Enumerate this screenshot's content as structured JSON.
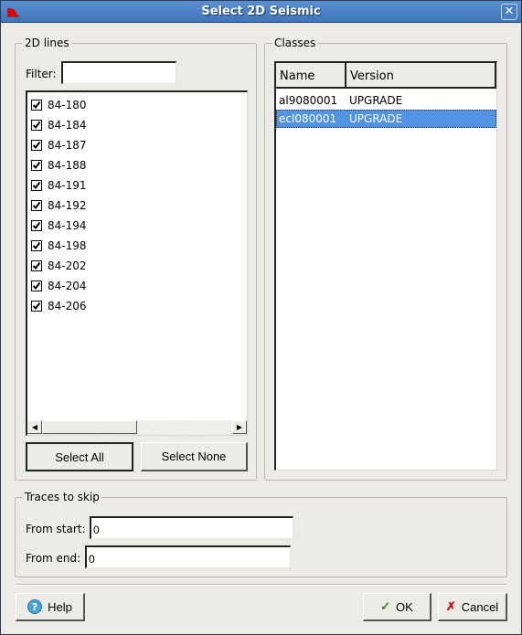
{
  "window": {
    "title": "Select 2D Seismic",
    "app_icon": "seismic-app-icon",
    "close_icon": "close-icon"
  },
  "lines_group": {
    "label": "2D lines",
    "filter_label": "Filter:",
    "filter_value": "",
    "items": [
      {
        "label": "84-180",
        "checked": true
      },
      {
        "label": "84-184",
        "checked": true
      },
      {
        "label": "84-187",
        "checked": true
      },
      {
        "label": "84-188",
        "checked": true
      },
      {
        "label": "84-191",
        "checked": true
      },
      {
        "label": "84-192",
        "checked": true
      },
      {
        "label": "84-194",
        "checked": true
      },
      {
        "label": "84-198",
        "checked": true
      },
      {
        "label": "84-202",
        "checked": true
      },
      {
        "label": "84-204",
        "checked": true
      },
      {
        "label": "84-206",
        "checked": true
      }
    ],
    "select_all_label": "Select All",
    "select_none_label": "Select None"
  },
  "classes_group": {
    "label": "Classes",
    "columns": [
      "Name",
      "Version"
    ],
    "rows": [
      {
        "name": "al9080001",
        "version": "UPGRADE",
        "selected": false
      },
      {
        "name": "ecl080001",
        "version": "UPGRADE",
        "selected": true
      }
    ]
  },
  "traces_group": {
    "label": "Traces to skip",
    "from_start_label": "From start:",
    "from_start_value": "0",
    "from_end_label": "From end:",
    "from_end_value": "0"
  },
  "footer": {
    "help_label": "Help",
    "ok_label": "OK",
    "cancel_label": "Cancel"
  }
}
